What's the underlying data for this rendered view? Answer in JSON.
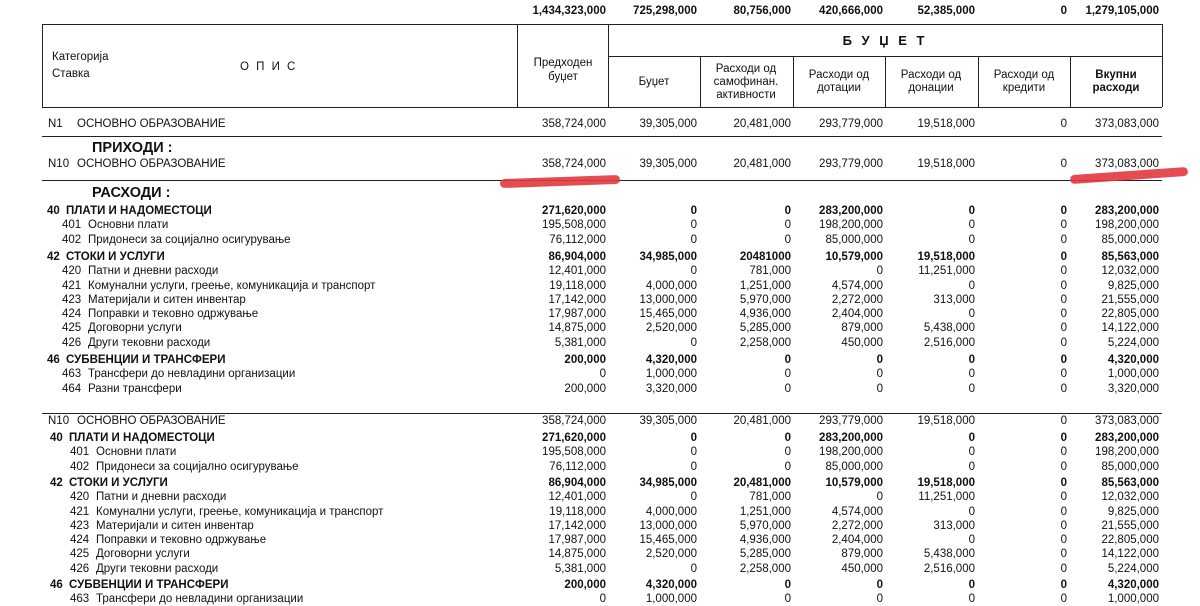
{
  "top_totals": [
    "1,434,323,000",
    "725,298,000",
    "80,756,000",
    "420,666,000",
    "52,385,000",
    "0",
    "1,279,105,000"
  ],
  "header": {
    "kategorija": "Категорија",
    "stavka": "Ставка",
    "opis": "О П И С",
    "predhoden": [
      "Предходен",
      "буџет"
    ],
    "budzet_title": "Б У Џ Е Т",
    "cols": [
      [
        "Буџет"
      ],
      [
        "Расходи од",
        "самофинан.",
        "активности"
      ],
      [
        "Расходи од",
        "дотации"
      ],
      [
        "Расходи од",
        "донации"
      ],
      [
        "Расходи од",
        "кредити"
      ],
      [
        "Вкупни",
        "расходи"
      ]
    ]
  },
  "n1": {
    "code": "N1",
    "label": "ОСНОВНО ОБРАЗОВАНИЕ",
    "values": [
      "358,724,000",
      "39,305,000",
      "20,481,000",
      "293,779,000",
      "19,518,000",
      "0",
      "373,083,000"
    ]
  },
  "prihodi_title": "ПРИХОДИ :",
  "n10a": {
    "code": "N10",
    "label": "ОСНОВНО ОБРАЗОВАНИЕ",
    "values": [
      "358,724,000",
      "39,305,000",
      "20,481,000",
      "293,779,000",
      "19,518,000",
      "0",
      "373,083,000"
    ]
  },
  "rashodi_title": "РАСХОДИ :",
  "block1": [
    {
      "code": "40",
      "label": "ПЛАТИ И НАДОМЕСТОЦИ",
      "bold": true,
      "values": [
        "271,620,000",
        "0",
        "0",
        "283,200,000",
        "0",
        "0",
        "283,200,000"
      ]
    },
    {
      "code": "401",
      "label": "Основни плати",
      "bold": false,
      "values": [
        "195,508,000",
        "0",
        "0",
        "198,200,000",
        "0",
        "0",
        "198,200,000"
      ]
    },
    {
      "code": "402",
      "label": "Придонеси за социјално осигурување",
      "bold": false,
      "values": [
        "76,112,000",
        "0",
        "0",
        "85,000,000",
        "0",
        "0",
        "85,000,000"
      ]
    },
    {
      "code": "42",
      "label": "СТОКИ И УСЛУГИ",
      "bold": true,
      "values": [
        "86,904,000",
        "34,985,000",
        "20481000",
        "10,579,000",
        "19,518,000",
        "0",
        "85,563,000"
      ]
    },
    {
      "code": "420",
      "label": "Патни и дневни расходи",
      "bold": false,
      "values": [
        "12,401,000",
        "0",
        "781,000",
        "0",
        "11,251,000",
        "0",
        "12,032,000"
      ]
    },
    {
      "code": "421",
      "label": "Комунални услуги, греење, комуникација и транспорт",
      "bold": false,
      "values": [
        "19,118,000",
        "4,000,000",
        "1,251,000",
        "4,574,000",
        "0",
        "0",
        "9,825,000"
      ]
    },
    {
      "code": "423",
      "label": "Материјали и ситен инвентар",
      "bold": false,
      "values": [
        "17,142,000",
        "13,000,000",
        "5,970,000",
        "2,272,000",
        "313,000",
        "0",
        "21,555,000"
      ]
    },
    {
      "code": "424",
      "label": "Поправки и тековно одржување",
      "bold": false,
      "values": [
        "17,987,000",
        "15,465,000",
        "4,936,000",
        "2,404,000",
        "0",
        "0",
        "22,805,000"
      ]
    },
    {
      "code": "425",
      "label": "Договорни услуги",
      "bold": false,
      "values": [
        "14,875,000",
        "2,520,000",
        "5,285,000",
        "879,000",
        "5,438,000",
        "0",
        "14,122,000"
      ]
    },
    {
      "code": "426",
      "label": "Други тековни расходи",
      "bold": false,
      "values": [
        "5,381,000",
        "0",
        "2,258,000",
        "450,000",
        "2,516,000",
        "0",
        "5,224,000"
      ]
    },
    {
      "code": "46",
      "label": "СУБВЕНЦИИ И ТРАНСФЕРИ",
      "bold": true,
      "values": [
        "200,000",
        "4,320,000",
        "0",
        "0",
        "0",
        "0",
        "4,320,000"
      ]
    },
    {
      "code": "463",
      "label": "Трансфери до невладини организации",
      "bold": false,
      "values": [
        "0",
        "1,000,000",
        "0",
        "0",
        "0",
        "0",
        "1,000,000"
      ]
    },
    {
      "code": "464",
      "label": "Разни трансфери",
      "bold": false,
      "values": [
        "200,000",
        "3,320,000",
        "0",
        "0",
        "0",
        "0",
        "3,320,000"
      ]
    }
  ],
  "n10b": {
    "code": "N10",
    "label": "ОСНОВНО ОБРАЗОВАНИЕ",
    "values": [
      "358,724,000",
      "39,305,000",
      "20,481,000",
      "293,779,000",
      "19,518,000",
      "0",
      "373,083,000"
    ]
  },
  "block2": [
    {
      "code": "40",
      "label": "ПЛАТИ И НАДОМЕСТОЦИ",
      "bold": true,
      "values": [
        "271,620,000",
        "0",
        "0",
        "283,200,000",
        "0",
        "0",
        "283,200,000"
      ]
    },
    {
      "code": "401",
      "label": "Основни плати",
      "bold": false,
      "values": [
        "195,508,000",
        "0",
        "0",
        "198,200,000",
        "0",
        "0",
        "198,200,000"
      ]
    },
    {
      "code": "402",
      "label": "Придонеси за социјално осигурување",
      "bold": false,
      "values": [
        "76,112,000",
        "0",
        "0",
        "85,000,000",
        "0",
        "0",
        "85,000,000"
      ]
    },
    {
      "code": "42",
      "label": "СТОКИ И УСЛУГИ",
      "bold": true,
      "values": [
        "86,904,000",
        "34,985,000",
        "20,481,000",
        "10,579,000",
        "19,518,000",
        "0",
        "85,563,000"
      ]
    },
    {
      "code": "420",
      "label": "Патни и дневни расходи",
      "bold": false,
      "values": [
        "12,401,000",
        "0",
        "781,000",
        "0",
        "11,251,000",
        "0",
        "12,032,000"
      ]
    },
    {
      "code": "421",
      "label": "Комунални услуги, греење, комуникација и транспорт",
      "bold": false,
      "values": [
        "19,118,000",
        "4,000,000",
        "1,251,000",
        "4,574,000",
        "0",
        "0",
        "9,825,000"
      ]
    },
    {
      "code": "423",
      "label": "Материјали и ситен инвентар",
      "bold": false,
      "values": [
        "17,142,000",
        "13,000,000",
        "5,970,000",
        "2,272,000",
        "313,000",
        "0",
        "21,555,000"
      ]
    },
    {
      "code": "424",
      "label": "Поправки и тековно одржување",
      "bold": false,
      "values": [
        "17,987,000",
        "15,465,000",
        "4,936,000",
        "2,404,000",
        "0",
        "0",
        "22,805,000"
      ]
    },
    {
      "code": "425",
      "label": "Договорни услуги",
      "bold": false,
      "values": [
        "14,875,000",
        "2,520,000",
        "5,285,000",
        "879,000",
        "5,438,000",
        "0",
        "14,122,000"
      ]
    },
    {
      "code": "426",
      "label": "Други тековни расходи",
      "bold": false,
      "values": [
        "5,381,000",
        "0",
        "2,258,000",
        "450,000",
        "2,516,000",
        "0",
        "5,224,000"
      ]
    },
    {
      "code": "46",
      "label": "СУБВЕНЦИИ И ТРАНСФЕРИ",
      "bold": true,
      "values": [
        "200,000",
        "4,320,000",
        "0",
        "0",
        "0",
        "0",
        "4,320,000"
      ]
    },
    {
      "code": "463",
      "label": "Трансфери до невладини организации",
      "bold": false,
      "values": [
        "0",
        "1,000,000",
        "0",
        "0",
        "0",
        "0",
        "1,000,000"
      ]
    }
  ],
  "highlight_color": "#e2393f"
}
